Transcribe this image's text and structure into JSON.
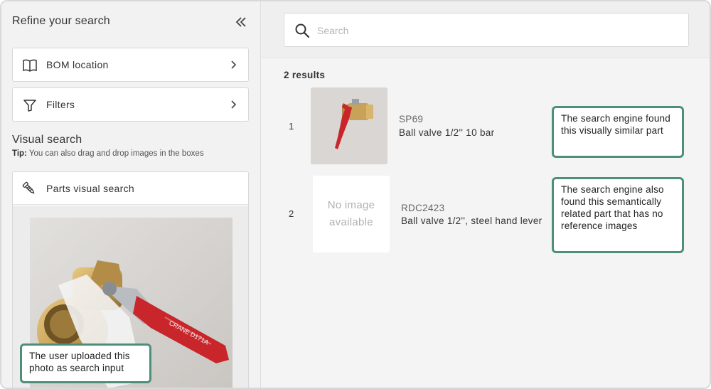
{
  "sidebar": {
    "title": "Refine your search",
    "collapse_icon": "double-chevron-left-icon",
    "nav": [
      {
        "label": "BOM location",
        "icon": "book-icon"
      },
      {
        "label": "Filters",
        "icon": "filter-icon"
      }
    ],
    "visual_search": {
      "heading": "Visual search",
      "tip_label": "Tip:",
      "tip_text": " You can also drag and drop images in the boxes",
      "parts_label": "Parts visual search",
      "parts_icon": "screw-icon",
      "photo_callout": "The user uploaded this photo as search input"
    }
  },
  "search": {
    "placeholder": "Search",
    "value": ""
  },
  "results": {
    "count_label": "2 results",
    "items": [
      {
        "index": "1",
        "code": "SP69",
        "name": "Ball valve 1/2'' 10 bar",
        "image": "red-handle-ball-valve-thumb",
        "callout": "The search engine found this visually similar part"
      },
      {
        "index": "2",
        "code": "RDC2423",
        "name": "Ball valve 1/2'', steel hand lever",
        "no_image_text": "No image available",
        "callout": "The search engine also found this semantically related part that has no reference images"
      }
    ]
  },
  "colors": {
    "callout_border": "#4e8f7c",
    "valve_handle": "#c8262b",
    "valve_brass": "#c9a25a"
  }
}
